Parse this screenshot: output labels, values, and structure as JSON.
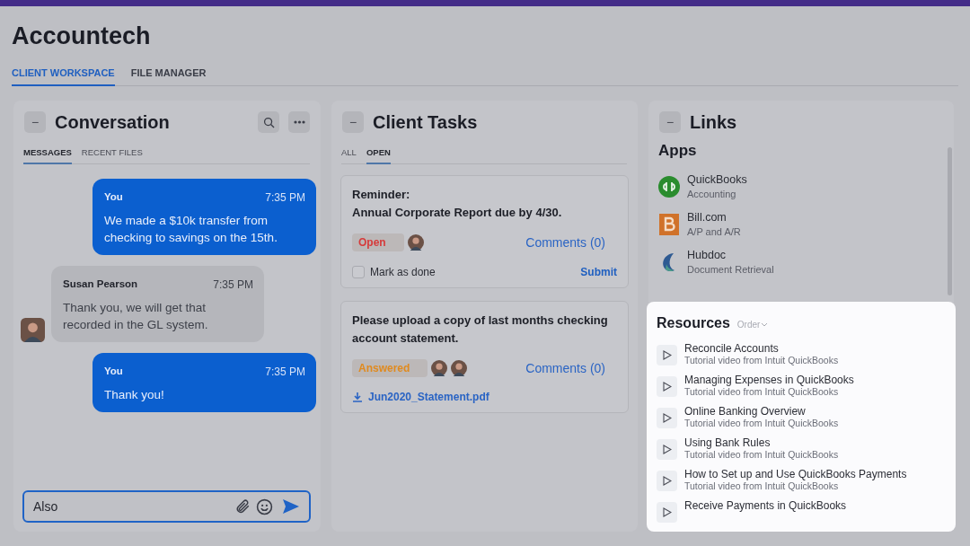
{
  "app": {
    "title": "Accountech"
  },
  "tabs": [
    {
      "label": "CLIENT WORKSPACE",
      "selected": true
    },
    {
      "label": "FILE MANAGER",
      "selected": false
    }
  ],
  "conversation": {
    "title": "Conversation",
    "collapse": "−",
    "tabs": [
      {
        "label": "MESSAGES",
        "selected": true
      },
      {
        "label": "RECENT FILES",
        "selected": false
      }
    ],
    "messages": [
      {
        "kind": "mine",
        "sender": "You",
        "time": "7:35 PM",
        "text": "We made a $10k transfer from checking to savings on the 15th."
      },
      {
        "kind": "theirs",
        "sender": "Susan Pearson",
        "time": "7:35 PM",
        "text": "Thank you, we will get that recorded in the GL system."
      },
      {
        "kind": "mine",
        "sender": "You",
        "time": "7:35 PM",
        "text": "Thank you!"
      }
    ],
    "composer": {
      "value": "Also",
      "focused": true
    }
  },
  "tasks": {
    "title": "Client Tasks",
    "collapse": "−",
    "tabs": [
      {
        "label": "ALL",
        "selected": false
      },
      {
        "label": "OPEN",
        "selected": true
      }
    ],
    "items": [
      {
        "lines": [
          "Reminder:",
          "Annual Corporate Report due by 4/30."
        ],
        "status": "Open",
        "color": "#d63b3b",
        "participants": [
          {
            "kind": "avatar"
          }
        ],
        "comments": "Comments (0)",
        "checkbox": {
          "label": "Mark as done",
          "checked": false
        },
        "action": "Submit"
      },
      {
        "lines": [
          "Please upload a copy of last months checking account statement."
        ],
        "status": "Answered",
        "color": "#e08a1e",
        "participants": [
          {
            "kind": "avatar"
          },
          {
            "kind": "avatar"
          }
        ],
        "comments": "Comments (0)",
        "attachment": "Jun2020_Statement.pdf"
      }
    ]
  },
  "links": {
    "title": "Links",
    "collapse": "−",
    "apps_title": "Apps",
    "apps": [
      {
        "kind": "qb",
        "name": "QuickBooks",
        "subtitle": "Accounting"
      },
      {
        "kind": "bill",
        "name": "Bill.com",
        "subtitle": "A/P and A/R"
      },
      {
        "kind": "hub",
        "name": "Hubdoc",
        "subtitle": "Document Retrieval"
      }
    ],
    "resources": {
      "title": "Resources",
      "order": "Order",
      "items": [
        {
          "title": "Reconcile Accounts",
          "subtitle": "Tutorial video from Intuit QuickBooks"
        },
        {
          "title": "Managing Expenses in QuickBooks",
          "subtitle": "Tutorial video from Intuit QuickBooks"
        },
        {
          "title": "Online Banking Overview",
          "subtitle": "Tutorial video from Intuit QuickBooks"
        },
        {
          "title": "Using Bank Rules",
          "subtitle": "Tutorial video from Intuit QuickBooks"
        },
        {
          "title": "How to Set up and Use QuickBooks Payments",
          "subtitle": "Tutorial video from Intuit QuickBooks"
        },
        {
          "title": "Receive Payments in QuickBooks"
        }
      ]
    }
  }
}
